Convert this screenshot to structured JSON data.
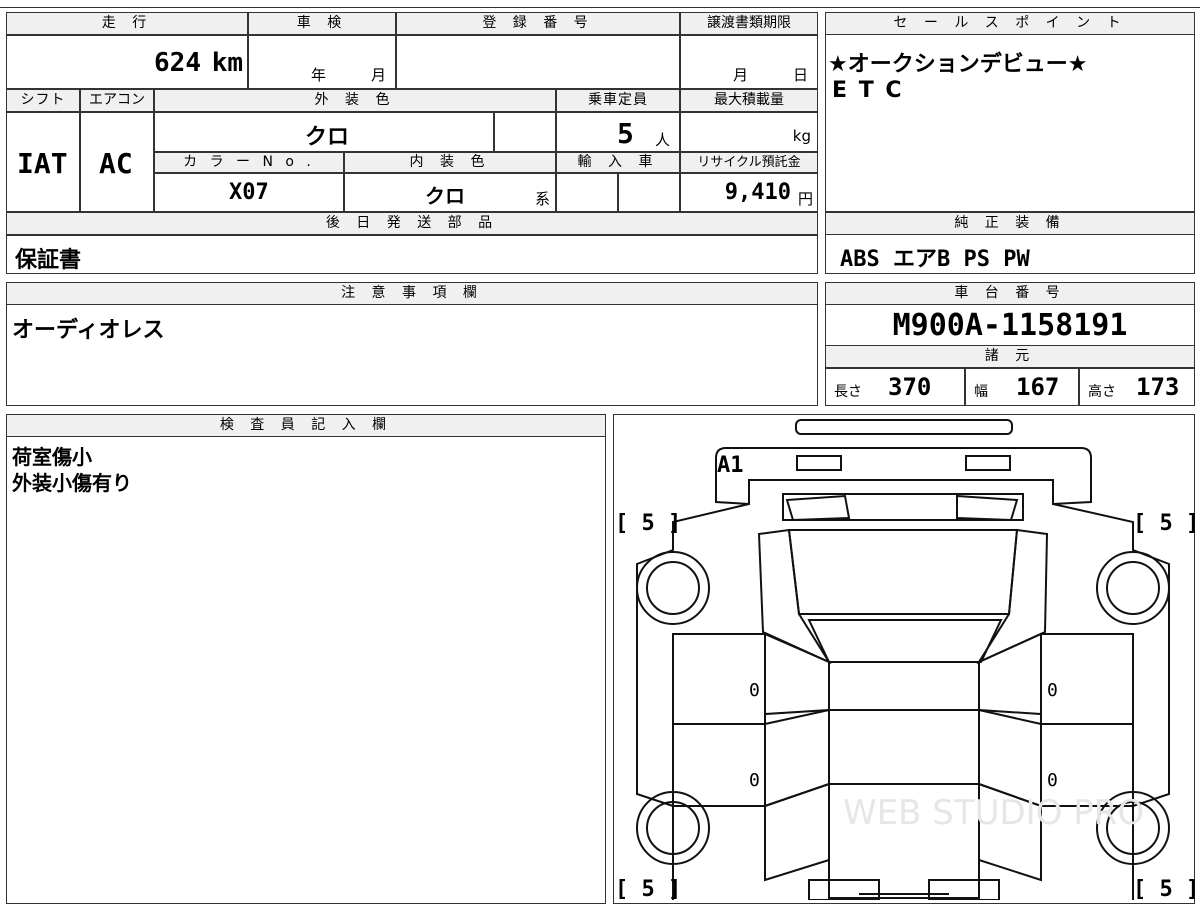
{
  "top_form": {
    "mileage_header": "走 行",
    "mileage_value": "624",
    "mileage_unit": "km",
    "shaken_header": "車 検",
    "shaken_year_label": "年",
    "shaken_month_label": "月",
    "registration_header": "登 録 番 号",
    "transfer_deadline_header": "譲渡書類期限",
    "transfer_month_label": "月",
    "transfer_day_label": "日",
    "shift_header": "シフト",
    "shift_value": "IAT",
    "ac_header": "エアコン",
    "ac_value": "AC",
    "exterior_color_header": "外 装 色",
    "exterior_color_value": "クロ",
    "capacity_header": "乗車定員",
    "capacity_value": "5",
    "capacity_unit": "人",
    "max_load_header": "最大積載量",
    "max_load_unit": "kg",
    "color_no_header": "カ ラ ー N o .",
    "color_no_value": "X07",
    "interior_color_header": "内 装 色",
    "interior_color_value": "クロ",
    "interior_color_suffix": "系",
    "import_header": "輸 入 車",
    "recycle_header": "リサイクル預託金",
    "recycle_value": "9,410",
    "recycle_unit": "円",
    "later_parts_header": "後 日 発 送 部 品",
    "later_parts_value": "保証書"
  },
  "sales_point": {
    "header": "セ ー ル ス ポ イ ン ト",
    "line1": "★オークションデビュー★",
    "line2": "E T C"
  },
  "genuine_equipment": {
    "header": "純 正 装 備",
    "value": "ABS エアB PS PW"
  },
  "notes": {
    "header": "注 意 事 項 欄",
    "value": "オーディオレス"
  },
  "chassis": {
    "header": "車 台 番 号",
    "value": "M900A-1158191"
  },
  "specs": {
    "header": "諸 元",
    "length_label": "長さ",
    "length_value": "370",
    "width_label": "幅",
    "width_value": "167",
    "height_label": "高さ",
    "height_value": "173"
  },
  "inspector": {
    "header": "検 査 員 記 入 欄",
    "line1": "荷室傷小",
    "line2": "外装小傷有り"
  },
  "diagram": {
    "damage_mark": "A1",
    "tire_front_left": "[ 5 ]",
    "tire_front_right": "[ 5 ]",
    "tire_rear_left": "[ 5 ]",
    "tire_rear_right": "[ 5 ]",
    "door_left_front": "0",
    "door_left_rear": "0",
    "door_right_front": "0",
    "door_right_rear": "0"
  }
}
